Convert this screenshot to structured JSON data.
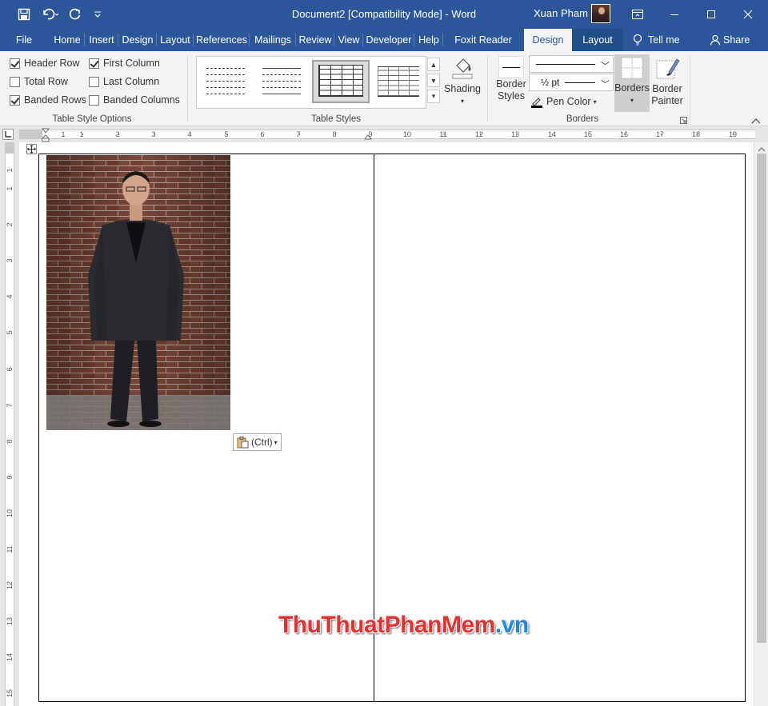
{
  "window": {
    "title": "Document2 [Compatibility Mode]  -  Word",
    "user_name": "Xuan Pham"
  },
  "tabs": [
    {
      "label": "File"
    },
    {
      "label": "Home"
    },
    {
      "label": "Insert"
    },
    {
      "label": "Design"
    },
    {
      "label": "Layout"
    },
    {
      "label": "References"
    },
    {
      "label": "Mailings"
    },
    {
      "label": "Review"
    },
    {
      "label": "View"
    },
    {
      "label": "Developer"
    },
    {
      "label": "Help"
    },
    {
      "label": "Foxit Reader PDF"
    },
    {
      "label": "Design"
    },
    {
      "label": "Layout"
    }
  ],
  "tell_me": "Tell me",
  "share": "Share",
  "table_style_options": {
    "group_label": "Table Style Options",
    "header_row": {
      "label": "Header Row",
      "checked": true
    },
    "first_column": {
      "label": "First Column",
      "checked": true
    },
    "total_row": {
      "label": "Total Row",
      "checked": false
    },
    "last_column": {
      "label": "Last Column",
      "checked": false
    },
    "banded_rows": {
      "label": "Banded Rows",
      "checked": true
    },
    "banded_columns": {
      "label": "Banded Columns",
      "checked": false
    }
  },
  "table_styles": {
    "group_label": "Table Styles",
    "shading_label": "Shading"
  },
  "borders": {
    "group_label": "Borders",
    "border_styles_line1": "Border",
    "border_styles_line2": "Styles",
    "weight_value": "½ pt",
    "pen_color_label": "Pen Color",
    "borders_label": "Borders",
    "border_painter_line1": "Border",
    "border_painter_line2": "Painter"
  },
  "ruler": {
    "h_numbers": [
      "1",
      "1",
      "2",
      "3",
      "4",
      "5",
      "6",
      "7",
      "8",
      "9",
      "10",
      "11",
      "12",
      "13",
      "14",
      "15",
      "16",
      "17",
      "18",
      "19"
    ],
    "v_numbers": [
      "1",
      "1",
      "2",
      "3",
      "4",
      "5",
      "6",
      "7",
      "8",
      "9",
      "10",
      "11",
      "12",
      "13",
      "14",
      "15"
    ]
  },
  "paste_options": {
    "label": "(Ctrl)"
  },
  "watermark": {
    "part1": "ThuThuat",
    "part2": "PhanMem",
    "part3": ".vn",
    "color1": "#e8312f",
    "color2": "#1e88e5"
  },
  "colors": {
    "word_blue": "#2b579a"
  }
}
